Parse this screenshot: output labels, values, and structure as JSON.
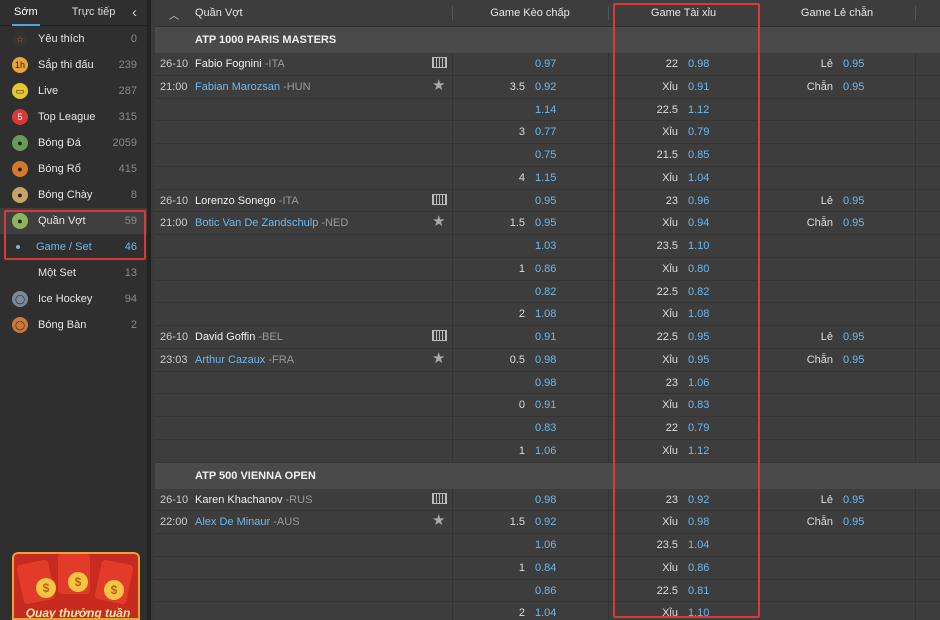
{
  "sidebar": {
    "tabs": [
      "Sớm",
      "Trực tiếp"
    ],
    "items": [
      {
        "label": "Yêu thích",
        "count": "0",
        "icon": "star-icon"
      },
      {
        "label": "Sắp thi đấu",
        "count": "239",
        "icon": "clock-icon"
      },
      {
        "label": "Live",
        "count": "287",
        "icon": "tv-icon"
      },
      {
        "label": "Top League",
        "count": "315",
        "icon": "top-league-icon"
      },
      {
        "label": "Bóng Đá",
        "count": "2059",
        "icon": "soccer-ball-icon"
      },
      {
        "label": "Bóng Rổ",
        "count": "415",
        "icon": "basketball-icon"
      },
      {
        "label": "Bóng Chày",
        "count": "8",
        "icon": "baseball-icon"
      },
      {
        "label": "Quần Vợt",
        "count": "59",
        "icon": "tennis-ball-icon"
      },
      {
        "label": "Game / Set",
        "count": "46",
        "icon": "dot-icon"
      },
      {
        "label": "Một Set",
        "count": "13",
        "icon": ""
      },
      {
        "label": "Ice Hockey",
        "count": "94",
        "icon": "hockey-icon"
      },
      {
        "label": "Bóng Bàn",
        "count": "2",
        "icon": "table-tennis-icon"
      }
    ],
    "promo": "Quay thưởng tuần"
  },
  "header": {
    "sport": "Quần Vợt",
    "col_handicap": "Game Kèo chấp",
    "col_ou": "Game Tài xỉu",
    "col_oe": "Game Lẻ chẵn"
  },
  "leagues": [
    {
      "name": "ATP 1000 PARIS MASTERS",
      "matches": [
        {
          "date": "26-10",
          "time": "21:00",
          "home": "Fabio Fognini",
          "home_cty": "-ITA",
          "away": "Fabian Marozsan",
          "away_cty": "-HUN",
          "rows": [
            {
              "hc": "",
              "hco": "0.97",
              "ou": "22",
              "ouo": "0.98",
              "oe": "Lẻ",
              "oeo": "0.95"
            },
            {
              "hc": "3.5",
              "hco": "0.92",
              "ou": "Xỉu",
              "ouo": "0.91",
              "oe": "Chẵn",
              "oeo": "0.95"
            },
            {
              "hc": "",
              "hco": "1.14",
              "ou": "22.5",
              "ouo": "1.12",
              "oe": "",
              "oeo": ""
            },
            {
              "hc": "3",
              "hco": "0.77",
              "ou": "Xỉu",
              "ouo": "0.79",
              "oe": "",
              "oeo": ""
            },
            {
              "hc": "",
              "hco": "0.75",
              "ou": "21.5",
              "ouo": "0.85",
              "oe": "",
              "oeo": ""
            },
            {
              "hc": "4",
              "hco": "1.15",
              "ou": "Xỉu",
              "ouo": "1.04",
              "oe": "",
              "oeo": ""
            }
          ]
        },
        {
          "date": "26-10",
          "time": "21:00",
          "home": "Lorenzo Sonego",
          "home_cty": "-ITA",
          "away": "Botic Van De Zandschulp",
          "away_cty": "-NED",
          "rows": [
            {
              "hc": "",
              "hco": "0.95",
              "ou": "23",
              "ouo": "0.96",
              "oe": "Lẻ",
              "oeo": "0.95"
            },
            {
              "hc": "1.5",
              "hco": "0.95",
              "ou": "Xỉu",
              "ouo": "0.94",
              "oe": "Chẵn",
              "oeo": "0.95"
            },
            {
              "hc": "",
              "hco": "1.03",
              "ou": "23.5",
              "ouo": "1.10",
              "oe": "",
              "oeo": ""
            },
            {
              "hc": "1",
              "hco": "0.86",
              "ou": "Xỉu",
              "ouo": "0.80",
              "oe": "",
              "oeo": ""
            },
            {
              "hc": "",
              "hco": "0.82",
              "ou": "22.5",
              "ouo": "0.82",
              "oe": "",
              "oeo": ""
            },
            {
              "hc": "2",
              "hco": "1.08",
              "ou": "Xỉu",
              "ouo": "1.08",
              "oe": "",
              "oeo": ""
            }
          ]
        },
        {
          "date": "26-10",
          "time": "23:03",
          "home": "David Goffin",
          "home_cty": "-BEL",
          "away": "Arthur Cazaux",
          "away_cty": "-FRA",
          "rows": [
            {
              "hc": "",
              "hco": "0.91",
              "ou": "22.5",
              "ouo": "0.95",
              "oe": "Lẻ",
              "oeo": "0.95"
            },
            {
              "hc": "0.5",
              "hco": "0.98",
              "ou": "Xỉu",
              "ouo": "0.95",
              "oe": "Chẵn",
              "oeo": "0.95"
            },
            {
              "hc": "",
              "hco": "0.98",
              "ou": "23",
              "ouo": "1.06",
              "oe": "",
              "oeo": ""
            },
            {
              "hc": "0",
              "hco": "0.91",
              "ou": "Xỉu",
              "ouo": "0.83",
              "oe": "",
              "oeo": ""
            },
            {
              "hc": "",
              "hco": "0.83",
              "ou": "22",
              "ouo": "0.79",
              "oe": "",
              "oeo": ""
            },
            {
              "hc": "1",
              "hco": "1.06",
              "ou": "Xỉu",
              "ouo": "1.12",
              "oe": "",
              "oeo": ""
            }
          ]
        }
      ]
    },
    {
      "name": "ATP 500 VIENNA OPEN",
      "matches": [
        {
          "date": "26-10",
          "time": "22:00",
          "home": "Karen Khachanov",
          "home_cty": "-RUS",
          "away": "Alex De Minaur",
          "away_cty": "-AUS",
          "rows": [
            {
              "hc": "",
              "hco": "0.98",
              "ou": "23",
              "ouo": "0.92",
              "oe": "Lẻ",
              "oeo": "0.95"
            },
            {
              "hc": "1.5",
              "hco": "0.92",
              "ou": "Xỉu",
              "ouo": "0.98",
              "oe": "Chẵn",
              "oeo": "0.95"
            },
            {
              "hc": "",
              "hco": "1.06",
              "ou": "23.5",
              "ouo": "1.04",
              "oe": "",
              "oeo": ""
            },
            {
              "hc": "1",
              "hco": "0.84",
              "ou": "Xỉu",
              "ouo": "0.86",
              "oe": "",
              "oeo": ""
            },
            {
              "hc": "",
              "hco": "0.86",
              "ou": "22.5",
              "ouo": "0.81",
              "oe": "",
              "oeo": ""
            },
            {
              "hc": "2",
              "hco": "1.04",
              "ou": "Xỉu",
              "ouo": "1.10",
              "oe": "",
              "oeo": ""
            }
          ]
        }
      ]
    }
  ]
}
